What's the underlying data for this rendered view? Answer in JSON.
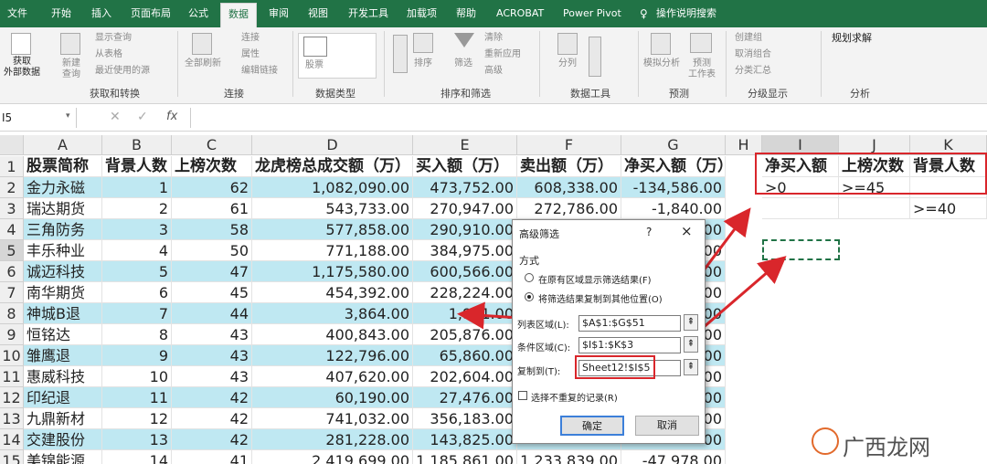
{
  "tabs": [
    "文件",
    "开始",
    "插入",
    "页面布局",
    "公式",
    "数据",
    "审阅",
    "视图",
    "开发工具",
    "加载项",
    "帮助",
    "ACROBAT",
    "Power Pivot",
    "操作说明搜索"
  ],
  "active_tab": "数据",
  "ribbon": {
    "get_external": "获取\n外部数据",
    "new_query": "新建\n查询",
    "show_query": "显示查询",
    "from_table": "从表格",
    "recent_sources": "最近使用的源",
    "refresh_all": "全部刷新",
    "connections": "连接",
    "properties": "属性",
    "edit_links": "编辑链接",
    "stocks": "股票",
    "sort": "排序",
    "filter": "筛选",
    "clear": "清除",
    "reapply": "重新应用",
    "advanced": "高级",
    "split": "分列",
    "whatif": "模拟分析",
    "forecast_sheet": "预测\n工作表",
    "group": "创建组",
    "ungroup": "取消组合",
    "subtotal": "分类汇总",
    "solver": "规划求解",
    "groups": [
      "获取和转换",
      "连接",
      "数据类型",
      "排序和筛选",
      "数据工具",
      "预测",
      "分级显示",
      "分析"
    ]
  },
  "formula_bar": {
    "name_box": "I5",
    "fx": "fx",
    "value": ""
  },
  "columns": [
    "A",
    "B",
    "C",
    "D",
    "E",
    "F",
    "G",
    "H",
    "I",
    "J",
    "K"
  ],
  "rows": [
    "1",
    "2",
    "3",
    "4",
    "5",
    "6",
    "7",
    "8",
    "9",
    "10",
    "11",
    "12",
    "13",
    "14",
    "15"
  ],
  "table": {
    "headers": [
      "股票简称",
      "背景人数",
      "上榜次数",
      "龙虎榜总成交额（万）",
      "买入额（万）",
      "卖出额（万）",
      "净买入额（万）"
    ],
    "data": [
      [
        "金力永磁",
        "1",
        "62",
        "1,082,090.00",
        "473,752.00",
        "608,338.00",
        "-134,586.00"
      ],
      [
        "瑞达期货",
        "2",
        "61",
        "543,733.00",
        "270,947.00",
        "272,786.00",
        "-1,840.00"
      ],
      [
        "三角防务",
        "3",
        "58",
        "577,858.00",
        "290,910.00",
        "",
        "00"
      ],
      [
        "丰乐种业",
        "4",
        "50",
        "771,188.00",
        "384,975.00",
        "",
        "00"
      ],
      [
        "诚迈科技",
        "5",
        "47",
        "1,175,580.00",
        "600,566.00",
        "",
        "00"
      ],
      [
        "南华期货",
        "6",
        "45",
        "454,392.00",
        "228,224.00",
        "",
        "00"
      ],
      [
        "神城B退",
        "7",
        "44",
        "3,864.00",
        "1,911.00",
        "",
        "00"
      ],
      [
        "恒铭达",
        "8",
        "43",
        "400,843.00",
        "205,876.00",
        "",
        "00"
      ],
      [
        "雏鹰退",
        "9",
        "43",
        "122,796.00",
        "65,860.00",
        "",
        "00"
      ],
      [
        "惠威科技",
        "10",
        "43",
        "407,620.00",
        "202,604.00",
        "",
        "00"
      ],
      [
        "印纪退",
        "11",
        "42",
        "60,190.00",
        "27,476.00",
        "",
        "00"
      ],
      [
        "九鼎新材",
        "12",
        "42",
        "741,032.00",
        "356,183.00",
        "",
        "00"
      ],
      [
        "交建股份",
        "13",
        "42",
        "281,228.00",
        "143,825.00",
        "",
        "00"
      ],
      [
        "美锦能源",
        "14",
        "41",
        "2,419,699.00",
        "1,185,861.00",
        "1,233,839.00",
        "-47,978.00"
      ]
    ]
  },
  "criteria": {
    "headers": [
      "净买入额",
      "上榜次数",
      "背景人数"
    ],
    "row2": [
      ">0",
      ">=45",
      ""
    ],
    "row3": [
      "",
      "",
      ">=40"
    ]
  },
  "dialog": {
    "title": "高级筛选",
    "help": "?",
    "close": "×",
    "mode_label": "方式",
    "option1": "在原有区域显示筛选结果(F)",
    "option2": "将筛选结果复制到其他位置(O)",
    "list_label": "列表区域(L):",
    "list_value": "$A$1:$G$51",
    "criteria_label": "条件区域(C):",
    "criteria_value": "$I$1:$K$3",
    "copy_label": "复制到(T):",
    "copy_value": "Sheet12!$I$5",
    "unique_label": "选择不重复的记录(R)",
    "ok": "确定",
    "cancel": "取消"
  },
  "watermark": "广西龙网",
  "colors": {
    "excel_green": "#217346",
    "row_band": "#bfe8f2",
    "red": "#d9262b"
  }
}
